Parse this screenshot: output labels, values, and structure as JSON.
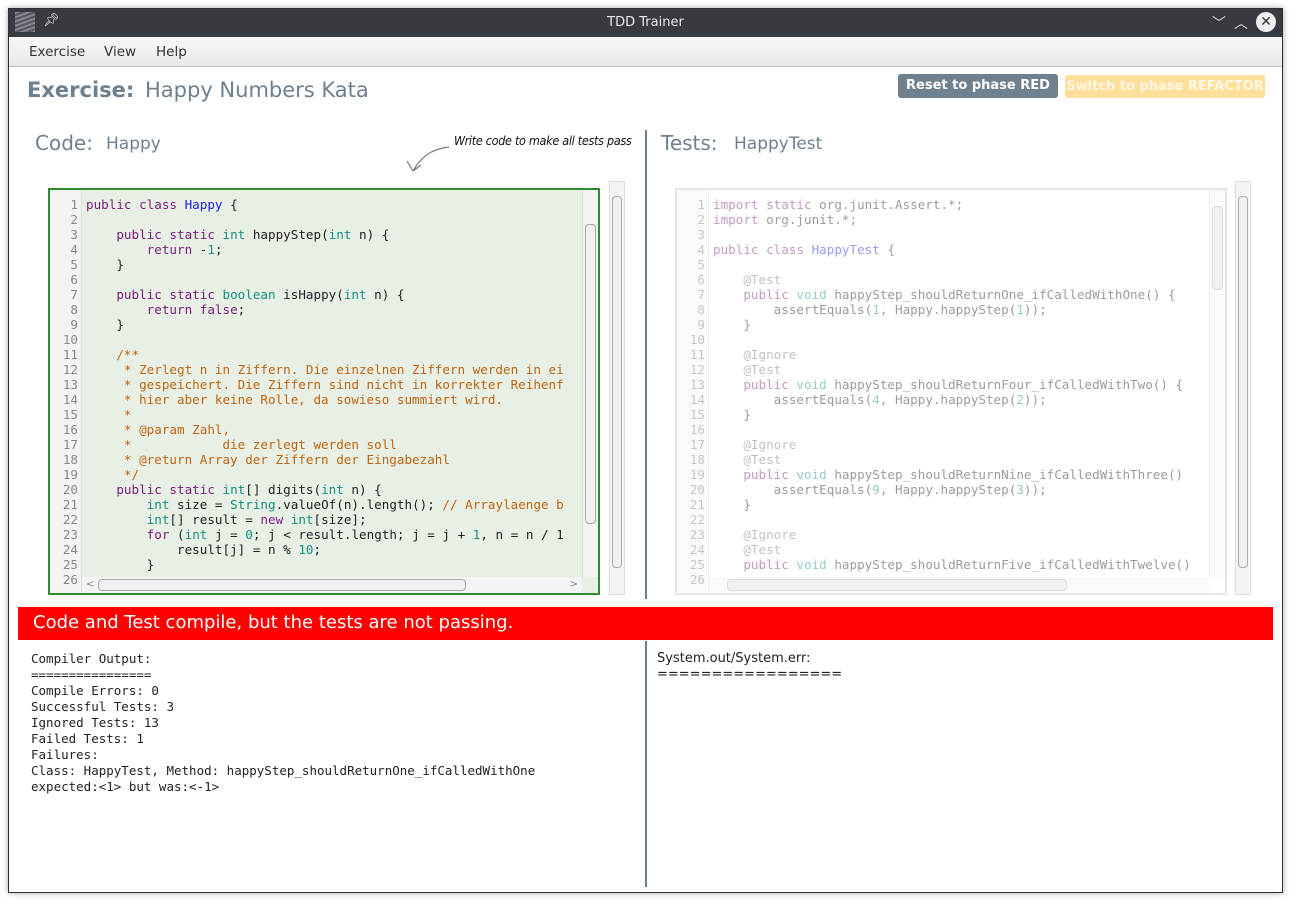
{
  "window": {
    "title": "TDD Trainer"
  },
  "menu": [
    "Exercise",
    "View",
    "Help"
  ],
  "header": {
    "label": "Exercise:",
    "name": "Happy Numbers Kata",
    "reset_button": "Reset to phase RED",
    "refactor_button": "Switch to phase REFACTOR"
  },
  "code_pane": {
    "label": "Code:",
    "name": "Happy",
    "hint": "Write code to make all tests pass",
    "lines": [
      [
        [
          "kw",
          "public class "
        ],
        [
          "cls",
          "Happy"
        ],
        [
          "pl",
          " {"
        ]
      ],
      [],
      [
        [
          "pl",
          "    "
        ],
        [
          "kw",
          "public static "
        ],
        [
          "ty",
          "int"
        ],
        [
          "pl",
          " happyStep("
        ],
        [
          "ty",
          "int"
        ],
        [
          "pl",
          " n) {"
        ]
      ],
      [
        [
          "pl",
          "        "
        ],
        [
          "kw",
          "return "
        ],
        [
          "pl",
          "-"
        ],
        [
          "num",
          "1"
        ],
        [
          "pl",
          ";"
        ]
      ],
      [
        [
          "pl",
          "    }"
        ]
      ],
      [],
      [
        [
          "pl",
          "    "
        ],
        [
          "kw",
          "public static "
        ],
        [
          "ty",
          "boolean"
        ],
        [
          "pl",
          " isHappy("
        ],
        [
          "ty",
          "int"
        ],
        [
          "pl",
          " n) {"
        ]
      ],
      [
        [
          "pl",
          "        "
        ],
        [
          "kw",
          "return false"
        ],
        [
          "pl",
          ";"
        ]
      ],
      [
        [
          "pl",
          "    }"
        ]
      ],
      [],
      [
        [
          "cm",
          "    /**"
        ]
      ],
      [
        [
          "cm",
          "     * Zerlegt n in Ziffern. Die einzelnen Ziffern werden in ei"
        ]
      ],
      [
        [
          "cm",
          "     * gespeichert. Die Ziffern sind nicht in korrekter Reihenf"
        ]
      ],
      [
        [
          "cm",
          "     * hier aber keine Rolle, da sowieso summiert wird."
        ]
      ],
      [
        [
          "cm",
          "     *"
        ]
      ],
      [
        [
          "cm",
          "     * @param Zahl,"
        ]
      ],
      [
        [
          "cm",
          "     *            die zerlegt werden soll"
        ]
      ],
      [
        [
          "cm",
          "     * @return Array der Ziffern der Eingabezahl"
        ]
      ],
      [
        [
          "cm",
          "     */"
        ]
      ],
      [
        [
          "pl",
          "    "
        ],
        [
          "kw",
          "public static "
        ],
        [
          "ty",
          "int"
        ],
        [
          "pl",
          "[] digits("
        ],
        [
          "ty",
          "int"
        ],
        [
          "pl",
          " n) {"
        ]
      ],
      [
        [
          "pl",
          "        "
        ],
        [
          "ty",
          "int"
        ],
        [
          "pl",
          " size = "
        ],
        [
          "ty",
          "String"
        ],
        [
          "pl",
          ".valueOf(n).length(); "
        ],
        [
          "cm",
          "// Arraylaenge b"
        ]
      ],
      [
        [
          "pl",
          "        "
        ],
        [
          "ty",
          "int"
        ],
        [
          "pl",
          "[] result = "
        ],
        [
          "kw",
          "new "
        ],
        [
          "ty",
          "int"
        ],
        [
          "pl",
          "[size];"
        ]
      ],
      [
        [
          "pl",
          "        "
        ],
        [
          "kw",
          "for "
        ],
        [
          "pl",
          "("
        ],
        [
          "ty",
          "int"
        ],
        [
          "pl",
          " j = "
        ],
        [
          "num",
          "0"
        ],
        [
          "pl",
          "; j < result.length; j = j + "
        ],
        [
          "num",
          "1"
        ],
        [
          "pl",
          ", n = n / 1"
        ]
      ],
      [
        [
          "pl",
          "            result[j] = n % "
        ],
        [
          "num",
          "10"
        ],
        [
          "pl",
          ";"
        ]
      ],
      [
        [
          "pl",
          "        }"
        ]
      ],
      []
    ]
  },
  "test_pane": {
    "label": "Tests:",
    "name": "HappyTest",
    "lines": [
      [
        [
          "kw",
          "import static "
        ],
        [
          "pl",
          "org.junit.Assert.*;"
        ]
      ],
      [
        [
          "kw",
          "import "
        ],
        [
          "pl",
          "org.junit.*;"
        ]
      ],
      [],
      [
        [
          "kw",
          "public class "
        ],
        [
          "cls",
          "HappyTest"
        ],
        [
          "pl",
          " {"
        ]
      ],
      [],
      [
        [
          "an",
          "    @Test"
        ]
      ],
      [
        [
          "pl",
          "    "
        ],
        [
          "kw",
          "public "
        ],
        [
          "ty",
          "void"
        ],
        [
          "pl",
          " happyStep_shouldReturnOne_ifCalledWithOne() {"
        ]
      ],
      [
        [
          "pl",
          "        assertEquals("
        ],
        [
          "num",
          "1"
        ],
        [
          "pl",
          ", Happy.happyStep("
        ],
        [
          "num",
          "1"
        ],
        [
          "pl",
          "));"
        ]
      ],
      [
        [
          "pl",
          "    }"
        ]
      ],
      [],
      [
        [
          "an",
          "    @Ignore"
        ]
      ],
      [
        [
          "an",
          "    @Test"
        ]
      ],
      [
        [
          "pl",
          "    "
        ],
        [
          "kw",
          "public "
        ],
        [
          "ty",
          "void"
        ],
        [
          "pl",
          " happyStep_shouldReturnFour_ifCalledWithTwo() {"
        ]
      ],
      [
        [
          "pl",
          "        assertEquals("
        ],
        [
          "num",
          "4"
        ],
        [
          "pl",
          ", Happy.happyStep("
        ],
        [
          "num",
          "2"
        ],
        [
          "pl",
          "));"
        ]
      ],
      [
        [
          "pl",
          "    }"
        ]
      ],
      [],
      [
        [
          "an",
          "    @Ignore"
        ]
      ],
      [
        [
          "an",
          "    @Test"
        ]
      ],
      [
        [
          "pl",
          "    "
        ],
        [
          "kw",
          "public "
        ],
        [
          "ty",
          "void"
        ],
        [
          "pl",
          " happyStep_shouldReturnNine_ifCalledWithThree()"
        ]
      ],
      [
        [
          "pl",
          "        assertEquals("
        ],
        [
          "num",
          "9"
        ],
        [
          "pl",
          ", Happy.happyStep("
        ],
        [
          "num",
          "3"
        ],
        [
          "pl",
          "));"
        ]
      ],
      [
        [
          "pl",
          "    }"
        ]
      ],
      [],
      [
        [
          "an",
          "    @Ignore"
        ]
      ],
      [
        [
          "an",
          "    @Test"
        ]
      ],
      [
        [
          "pl",
          "    "
        ],
        [
          "kw",
          "public "
        ],
        [
          "ty",
          "void"
        ],
        [
          "pl",
          " happyStep_shouldReturnFive_ifCalledWithTwelve()"
        ]
      ],
      []
    ]
  },
  "status": {
    "message": "Code and Test compile, but the tests are not passing.",
    "color": "#ff0000"
  },
  "output": {
    "compiler": [
      "Compiler Output:",
      "================",
      "Compile Errors: 0",
      "Successful Tests: 3",
      "Ignored Tests: 13",
      "Failed Tests: 1",
      "Failures:",
      "Class: HappyTest, Method: happyStep_shouldReturnOne_ifCalledWithOne",
      "expected:<1> but was:<-1>"
    ],
    "console": [
      "System.out/System.err:",
      "================="
    ]
  }
}
